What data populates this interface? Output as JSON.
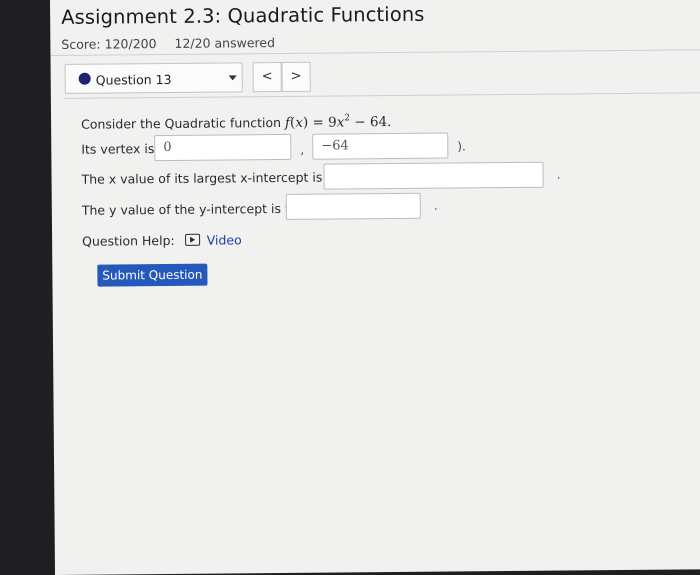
{
  "assignment": {
    "title": "Assignment 2.3: Quadratic Functions",
    "score_label": "Score: 120/200",
    "answered_label": "12/20 answered"
  },
  "question_nav": {
    "current": "Question 13",
    "prev_symbol": "<",
    "next_symbol": ">"
  },
  "question": {
    "intro": "Consider the Quadratic function",
    "function": {
      "name": "f",
      "var": "x",
      "eq": " = 9",
      "exp": "2",
      "rest": " − 64."
    },
    "vertex_label": "Its vertex is (",
    "vertex_x": "0",
    "vertex_sep": ",",
    "vertex_y": "−64",
    "vertex_close": ").",
    "x_intercept_label": "The x value of its largest x-intercept is x =",
    "x_intercept_value": "",
    "x_intercept_end": ".",
    "y_intercept_label": "The y value of the y-intercept is y =",
    "y_intercept_value": "",
    "y_intercept_end": "."
  },
  "help": {
    "label": "Question Help:",
    "video_label": "Video"
  },
  "submit_label": "Submit Question",
  "colors": {
    "accent": "#2558bb",
    "question_dot": "#1d2370",
    "link": "#1f3aa8"
  }
}
